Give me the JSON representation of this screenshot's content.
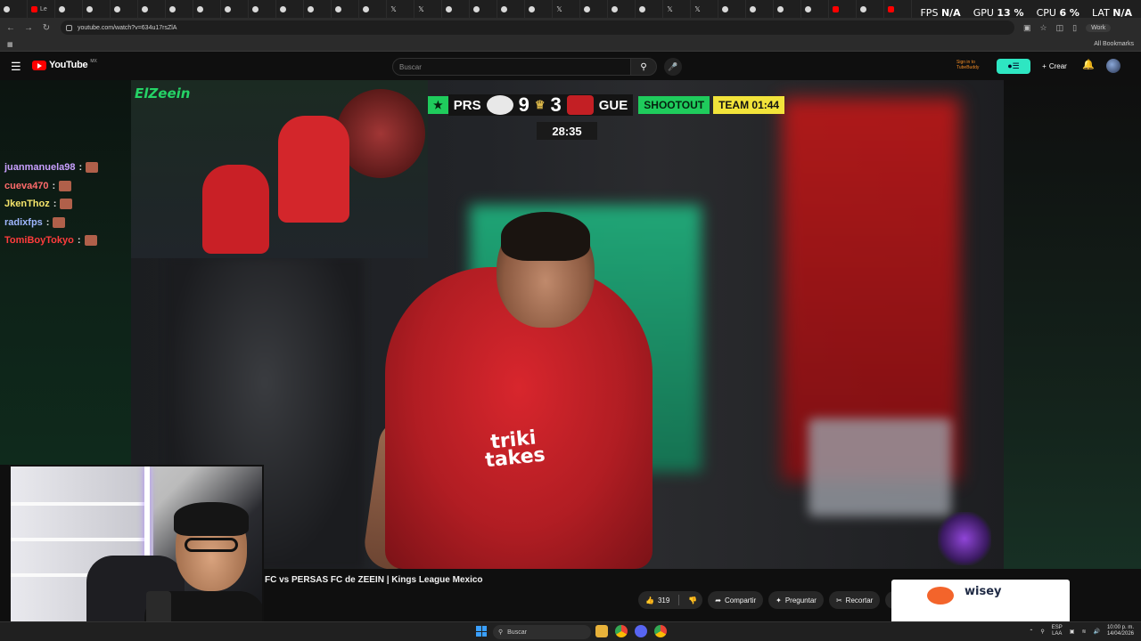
{
  "browser": {
    "tabs": [
      {
        "icon": "tiktok"
      },
      {
        "icon": "youtube",
        "label": "Le"
      },
      {
        "icon": "tiktok"
      },
      {
        "icon": "tiktok"
      },
      {
        "icon": "tiktok"
      },
      {
        "icon": "tiktok"
      },
      {
        "icon": "tiktok"
      },
      {
        "icon": "tiktok"
      },
      {
        "icon": "tiktok"
      },
      {
        "icon": "tiktok"
      },
      {
        "icon": "tiktok"
      },
      {
        "icon": "tiktok"
      },
      {
        "icon": "tiktok"
      },
      {
        "icon": "tiktok"
      },
      {
        "icon": "x"
      },
      {
        "icon": "x"
      },
      {
        "icon": "tiktok"
      },
      {
        "icon": "tiktok"
      },
      {
        "icon": "tiktok"
      },
      {
        "icon": "tiktok"
      },
      {
        "icon": "x"
      },
      {
        "icon": "tiktok"
      },
      {
        "icon": "tiktok"
      },
      {
        "icon": "tiktok"
      },
      {
        "icon": "x"
      },
      {
        "icon": "x"
      },
      {
        "icon": "tiktok"
      },
      {
        "icon": "tiktok"
      },
      {
        "icon": "tiktok"
      },
      {
        "icon": "tiktok"
      },
      {
        "icon": "youtube"
      },
      {
        "icon": "tiktok"
      },
      {
        "icon": "youtube"
      }
    ],
    "url": "youtube.com/watch?v=634u17rsZlA",
    "profile_label": "Work",
    "all_bookmarks": "All Bookmarks"
  },
  "overlay_stats": {
    "fps_label": "FPS",
    "fps_value": "N/A",
    "gpu_label": "GPU",
    "gpu_value": "13 %",
    "cpu_label": "CPU",
    "cpu_value": "6 %",
    "lat_label": "LAT",
    "lat_value": "N/A"
  },
  "youtube": {
    "logo_text": "YouTube",
    "country_code": "MX",
    "search_placeholder": "Buscar",
    "tubebuddy_line1": "Sign in to",
    "tubebuddy_line2": "TubeBuddy",
    "create_label": "Crear"
  },
  "chat": [
    {
      "user": "juanmanuela98",
      "color": "#c9a0ff"
    },
    {
      "user": "cueva470",
      "color": "#ff6b6b"
    },
    {
      "user": "JkenThoz",
      "color": "#f5e56b"
    },
    {
      "user": "radixfps",
      "color": "#9fb7ff"
    },
    {
      "user": "TomiBoyTokyo",
      "color": "#ff3c3c"
    }
  ],
  "video": {
    "inset_logo": "ElZeein",
    "score": {
      "home_team": "PRS",
      "home_score": "9",
      "away_score": "3",
      "away_team": "GUE",
      "mode": "SHOOTOUT",
      "team_time": "TEAM 01:44",
      "clock": "28:35"
    },
    "sponsor_text": "triki takes"
  },
  "below_video": {
    "title": "FC vs PERSAS FC de ZEEIN | Kings League Mexico",
    "likes": "319",
    "share_label": "Compartir",
    "ask_label": "Preguntar",
    "clip_label": "Recortar"
  },
  "ad": {
    "brand": "wisey"
  },
  "taskbar": {
    "search_label": "Buscar",
    "lang_line1": "ESP",
    "lang_line2": "LAA",
    "time": "10:00 p. m.",
    "date": "14/04/2026"
  }
}
